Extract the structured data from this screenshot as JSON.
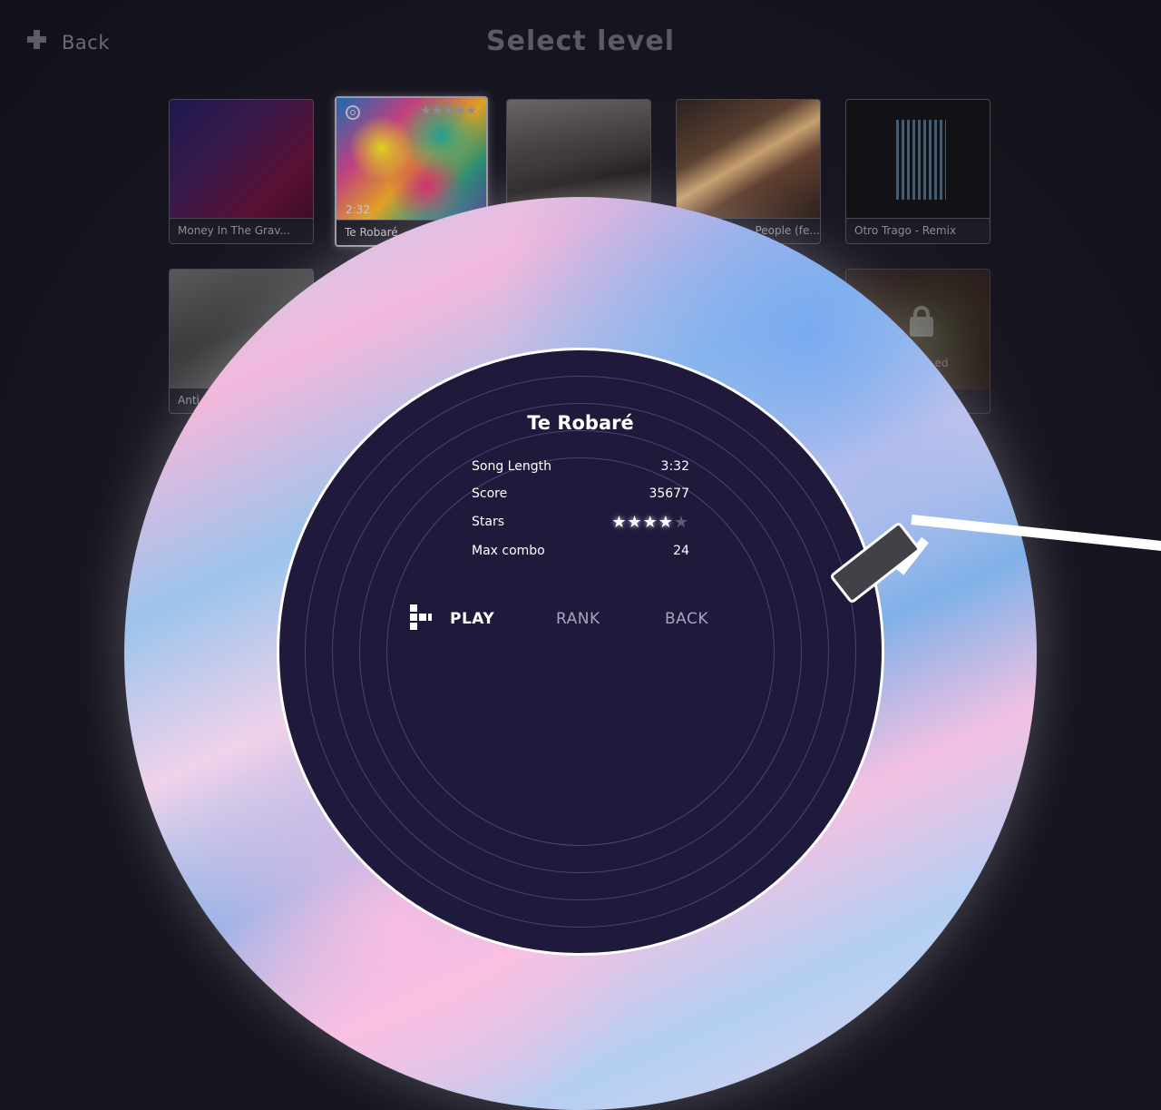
{
  "header": {
    "back_label": "Back",
    "title": "Select level"
  },
  "levels": [
    {
      "name": "Money In The Grav..."
    },
    {
      "name": "Te Robaré",
      "duration": "2:32",
      "stars_text": "★★★★★"
    },
    {
      "name": ""
    },
    {
      "name": "...People (fe..."
    },
    {
      "name": "Otro Trago - Remix"
    },
    {
      "name": "Anti..."
    },
    {
      "name": "...ed"
    }
  ],
  "details": {
    "title": "Te Robaré",
    "stats": [
      {
        "label": "Song Length",
        "value": "3:32"
      },
      {
        "label": "Score",
        "value": "35677"
      },
      {
        "label": "Stars",
        "value": "4/5"
      },
      {
        "label": "Max combo",
        "value": "24"
      }
    ],
    "stars_on": "★★★★",
    "stars_off": "★"
  },
  "menu": {
    "play": "PLAY",
    "rank": "RANK",
    "back": "BACK"
  }
}
